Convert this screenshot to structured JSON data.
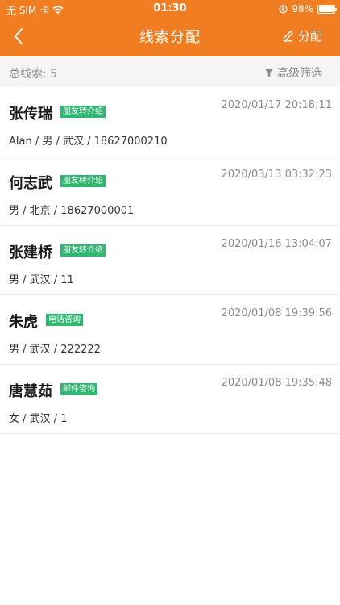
{
  "status_bar": {
    "carrier": "无 SIM 卡",
    "time": "01:30",
    "battery": "98%",
    "battery_level": 0.98
  },
  "nav": {
    "title": "线索分配",
    "assign_label": "分配",
    "back_icon": "chevron-left-icon",
    "assign_icon": "pencil-icon"
  },
  "summary": {
    "total_label": "总线索: 5",
    "filter_label": "高级筛选",
    "filter_icon": "funnel-icon"
  },
  "leads": [
    {
      "name": "张传瑞",
      "tag": "朋友转介绍",
      "time": "2020/01/17 20:18:11",
      "info": "Alan / 男 / 武汉 / 18627000210"
    },
    {
      "name": "何志武",
      "tag": "朋友转介绍",
      "time": "2020/03/13 03:32:23",
      "info": "男 / 北京 / 18627000001"
    },
    {
      "name": "张建桥",
      "tag": "朋友转介绍",
      "time": "2020/01/16 13:04:07",
      "info": "男 / 武汉 / 11"
    },
    {
      "name": "朱虎",
      "tag": "电话咨询",
      "time": "2020/01/08 19:39:56",
      "info": "男 / 武汉 / 222222"
    },
    {
      "name": "唐慧茹",
      "tag": "邮件咨询",
      "time": "2020/01/08 19:35:48",
      "info": "女 / 武汉 / 1"
    }
  ],
  "colors": {
    "header": "#F07D22",
    "tag": "#2EB872",
    "summary_bg": "#F5F5F5"
  }
}
